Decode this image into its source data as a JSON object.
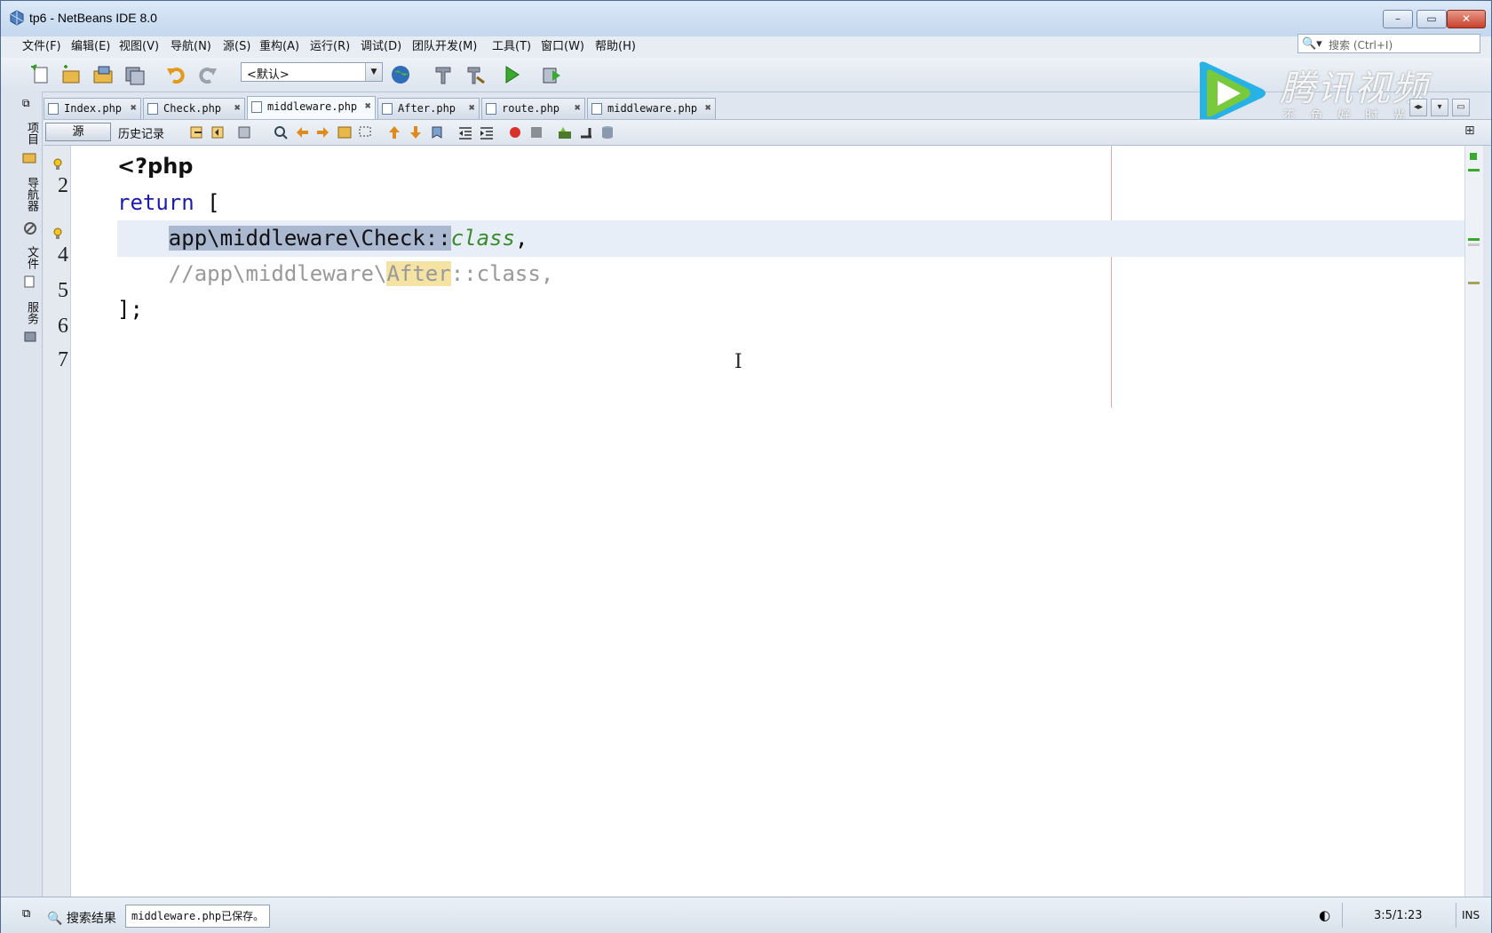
{
  "window": {
    "title": "tp6 - NetBeans IDE 8.0",
    "buttons": {
      "minimize": "–",
      "maximize": "▭",
      "close": "✕"
    }
  },
  "menu": [
    {
      "label": "文件(F)"
    },
    {
      "label": "编辑(E)"
    },
    {
      "label": "视图(V)"
    },
    {
      "label": "导航(N)"
    },
    {
      "label": "源(S)"
    },
    {
      "label": "重构(A)"
    },
    {
      "label": "运行(R)"
    },
    {
      "label": "调试(D)"
    },
    {
      "label": "团队开发(M)"
    },
    {
      "label": "工具(T)"
    },
    {
      "label": "窗口(W)"
    },
    {
      "label": "帮助(H)"
    }
  ],
  "search": {
    "placeholder": "搜索 (Ctrl+I)",
    "icon": "magnifier-icon"
  },
  "toolbar": {
    "config_value": "<默认>"
  },
  "left_panels": [
    {
      "label": "项目"
    },
    {
      "label": "导航器"
    },
    {
      "label": "文件"
    },
    {
      "label": "服务"
    }
  ],
  "tabs": [
    {
      "label": "Index.php"
    },
    {
      "label": "Check.php"
    },
    {
      "label": "middleware.php"
    },
    {
      "label": "After.php"
    },
    {
      "label": "route.php"
    },
    {
      "label": "middleware.php"
    }
  ],
  "editor_toolbar": {
    "source": "源",
    "history": "历史记录"
  },
  "editor": {
    "line_numbers": [
      "2",
      "4",
      "5",
      "6",
      "7"
    ],
    "code": {
      "l1": "<?php",
      "l2_kw": "return",
      "l2_rest": " [",
      "l3_indent": "    ",
      "l3_sel": "app\\middleware\\Check::",
      "l3_kw": "class",
      "l3_end": ",",
      "l4_pre": "    //app\\middleware\\",
      "l4_hl": "After",
      "l4_post": "::class,",
      "l5": "];"
    }
  },
  "status": {
    "search_results": "搜索结果",
    "saved_message": "middleware.php已保存。",
    "position": "3:5/1:23",
    "mode": "INS"
  },
  "watermark": {
    "name": "腾讯视频",
    "slogan": "不负好时光"
  },
  "colors": {
    "keyword": "#1b1bb0",
    "selection": "#aab8d0",
    "highlight": "#f4e3a2",
    "comment": "#999999"
  }
}
